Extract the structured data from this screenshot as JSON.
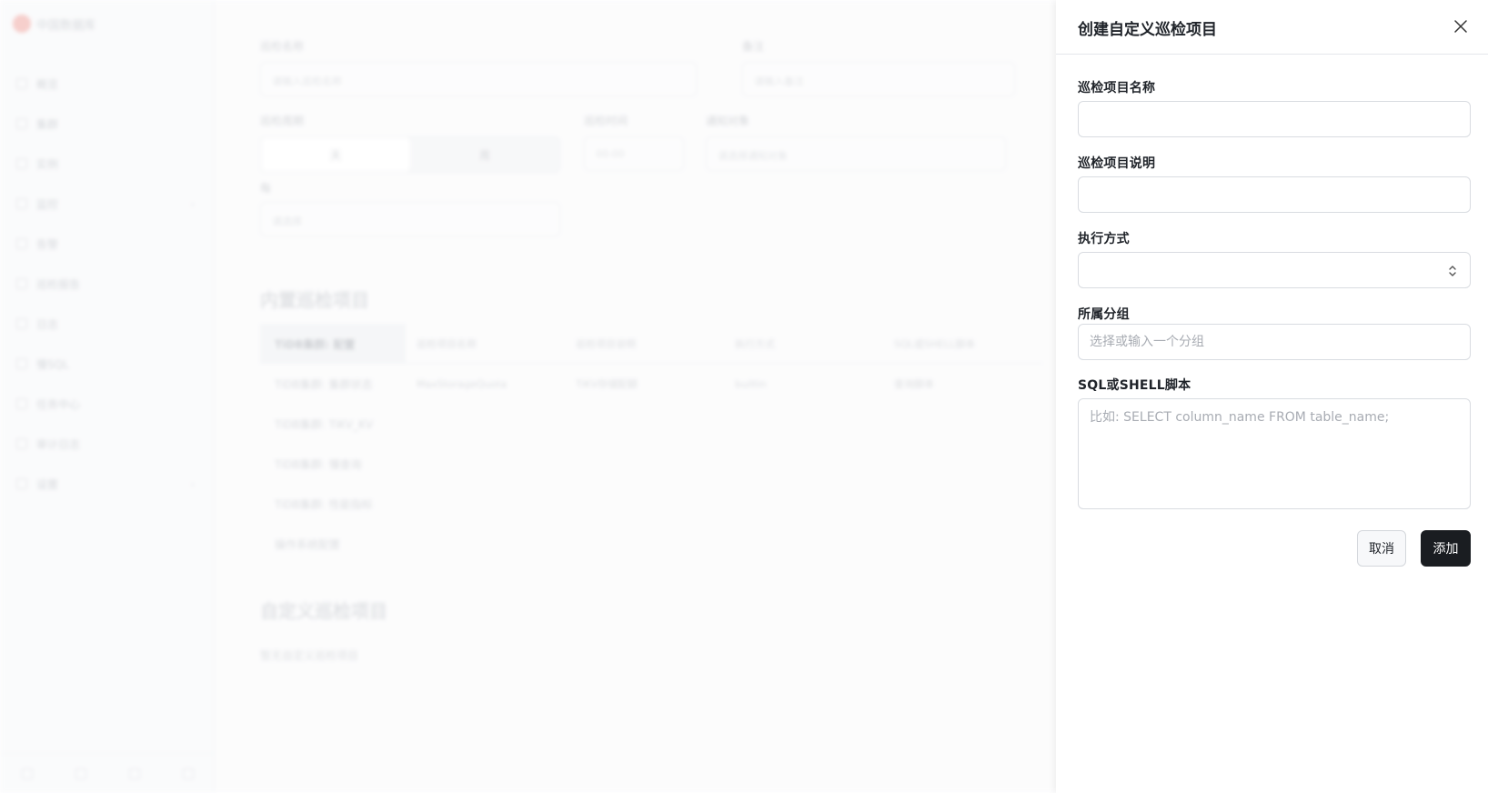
{
  "background": {
    "brand": "中国数据库",
    "nav": [
      "概览",
      "集群",
      "实例",
      "监控",
      "告警",
      "巡检报告",
      "日志",
      "慢SQL",
      "任务中心",
      "审计日志",
      "设置"
    ],
    "form": {
      "field1_label": "巡检名称",
      "field1_placeholder": "请输入巡检名称",
      "field2_label": "备注",
      "field2_placeholder": "请输入备注",
      "cycle_label": "巡检周期",
      "seg_options": [
        "天",
        "周"
      ],
      "time_label": "巡检时间",
      "time_value": "00:00",
      "notify_label": "通知对象",
      "notify_placeholder": "请选择通知对象",
      "day_label": "每",
      "day_placeholder": "请选择"
    },
    "builtin_title": "内置巡检项目",
    "groups": [
      "TiDB集群: 配置",
      "TiDB集群: 集群状态",
      "TiDB集群: TiKV_KV",
      "TiDB集群: 慢查询",
      "TiDB集群: 性能指标",
      "操作系统配置"
    ],
    "table_headers": [
      "巡检项目名称",
      "巡检项目说明",
      "执行方式",
      "SQL或SHELL脚本"
    ],
    "table_row": [
      "MaxStorageQuota",
      "TiKV存储配额",
      "builtin",
      "查询脚本"
    ],
    "custom_title": "自定义巡检项目",
    "custom_empty": "暂无自定义巡检项目"
  },
  "drawer": {
    "title": "创建自定义巡检项目",
    "name_label": "巡检项目名称",
    "name_value": "",
    "desc_label": "巡检项目说明",
    "desc_value": "",
    "exec_label": "执行方式",
    "exec_value": "",
    "group_label": "所属分组",
    "group_placeholder": "选择或输入一个分组",
    "script_label": "SQL或SHELL脚本",
    "script_placeholder": "比如: SELECT column_name FROM table_name;",
    "cancel_label": "取消",
    "add_label": "添加"
  },
  "colors": {
    "primary_button": "#1a1d21",
    "border": "#d9dce1",
    "placeholder": "#a8acb3"
  },
  "icons": {
    "close": "close-icon",
    "select": "chevron-up-down-icon"
  }
}
